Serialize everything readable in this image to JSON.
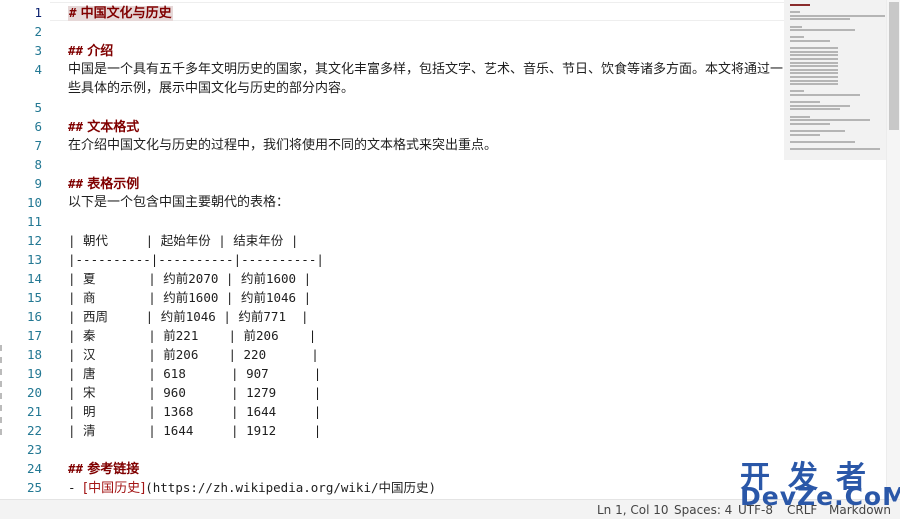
{
  "editor": {
    "lines": [
      {
        "n": "1",
        "kind": "h1",
        "marker": "#",
        "text": "中国文化与历史"
      },
      {
        "n": "2",
        "kind": "blank"
      },
      {
        "n": "3",
        "kind": "h2",
        "marker": "##",
        "text": "介绍"
      },
      {
        "n": "4",
        "kind": "wrap",
        "text": "中国是一个具有五千多年文明历史的国家，其文化丰富多样，包括文字、艺术、音乐、节日、饮食等诸多方面。本文将通过一些具体的示例，展示中国文化与历史的部分内容。"
      },
      {
        "n": "5",
        "kind": "blank"
      },
      {
        "n": "6",
        "kind": "h2",
        "marker": "##",
        "text": "文本格式"
      },
      {
        "n": "7",
        "kind": "para",
        "text": "在介绍中国文化与历史的过程中，我们将使用不同的文本格式来突出重点。"
      },
      {
        "n": "8",
        "kind": "blank"
      },
      {
        "n": "9",
        "kind": "h2",
        "marker": "##",
        "text": "表格示例"
      },
      {
        "n": "10",
        "kind": "para",
        "text": "以下是一个包含中国主要朝代的表格："
      },
      {
        "n": "11",
        "kind": "blank"
      },
      {
        "n": "12",
        "kind": "table",
        "text": "| 朝代     | 起始年份 | 结束年份 |"
      },
      {
        "n": "13",
        "kind": "table",
        "text": "|----------|----------|----------|"
      },
      {
        "n": "14",
        "kind": "table",
        "text": "| 夏       | 约前2070 | 约前1600 |"
      },
      {
        "n": "15",
        "kind": "table",
        "text": "| 商       | 约前1600 | 约前1046 |"
      },
      {
        "n": "16",
        "kind": "table",
        "text": "| 西周     | 约前1046 | 约前771  |"
      },
      {
        "n": "17",
        "kind": "table",
        "text": "| 秦       | 前221    | 前206    |"
      },
      {
        "n": "18",
        "kind": "table",
        "text": "| 汉       | 前206    | 220      |"
      },
      {
        "n": "19",
        "kind": "table",
        "text": "| 唐       | 618      | 907      |"
      },
      {
        "n": "20",
        "kind": "table",
        "text": "| 宋       | 960      | 1279     |"
      },
      {
        "n": "21",
        "kind": "table",
        "text": "| 明       | 1368     | 1644     |"
      },
      {
        "n": "22",
        "kind": "table",
        "text": "| 清       | 1644     | 1912     |"
      },
      {
        "n": "23",
        "kind": "blank"
      },
      {
        "n": "24",
        "kind": "h2",
        "marker": "##",
        "text": "参考链接"
      },
      {
        "n": "25",
        "kind": "link",
        "prefix": "- ",
        "label": "[中国历史]",
        "url": "(https://zh.wikipedia.org/wiki/中国历史)"
      }
    ]
  },
  "statusbar": {
    "position": "Ln 1, Col 10",
    "spaces": "Spaces: 4",
    "encoding": "UTF-8",
    "eol": "CRLF",
    "language": "Markdown"
  },
  "watermark": {
    "line1": "开发者",
    "line2": "DevZe.CoM"
  },
  "colors": {
    "heading": "#800000",
    "line_number": "#237893",
    "link_text": "#a31515",
    "watermark": "#2a57a8"
  }
}
